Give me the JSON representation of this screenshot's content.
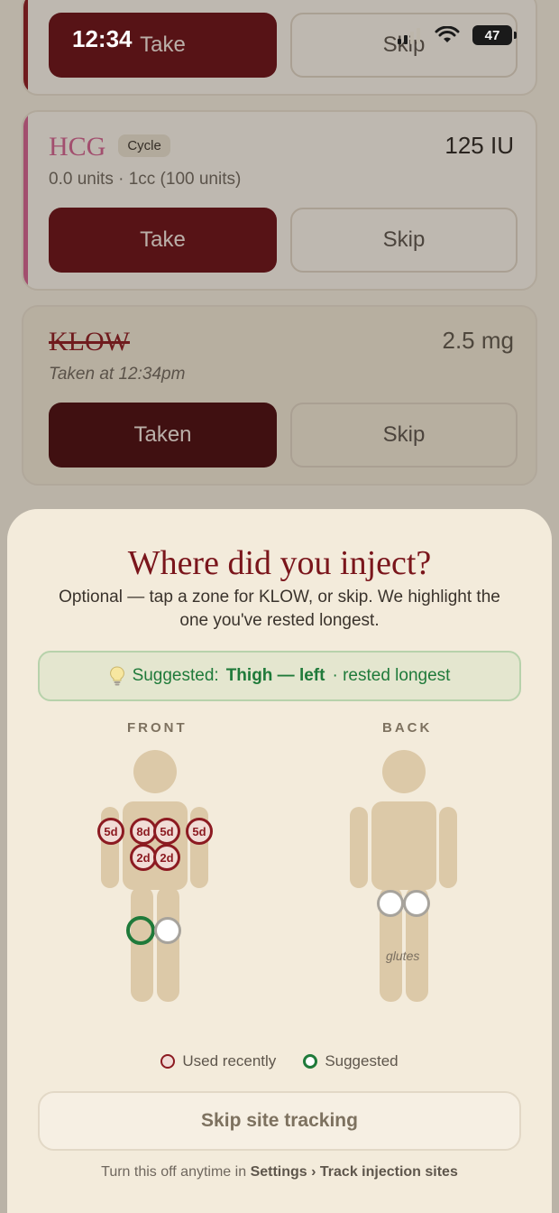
{
  "status_bar": {
    "time": "12:34",
    "battery": "47"
  },
  "cards": [
    {
      "take_label": "Take",
      "skip_label": "Skip"
    },
    {
      "name": "HCG",
      "tag": "Cycle",
      "dose": "125 IU",
      "sub": "0.0 units · 1cc (100 units)",
      "take_label": "Take",
      "skip_label": "Skip",
      "accent": "#d1608f",
      "name_color": "#d1608f"
    },
    {
      "name": "KLOW",
      "dose": "2.5 mg",
      "sub": "Taken at 12:34pm",
      "take_label": "Taken",
      "skip_label": "Skip",
      "accent": "#8c1a21",
      "name_color": "#8c1a21"
    }
  ],
  "sheet": {
    "title": "Where did you inject?",
    "description": "Optional — tap a zone for KLOW, or skip. We highlight the one you've rested longest.",
    "suggestion": {
      "prefix": "Suggested:",
      "site": "Thigh — left",
      "suffix": "· rested longest",
      "icon": "lightbulb-icon"
    },
    "front_label": "FRONT",
    "back_label": "BACK",
    "front_sites": [
      {
        "label": "5d",
        "status": "used"
      },
      {
        "label": "8d",
        "status": "used"
      },
      {
        "label": "5d",
        "status": "used"
      },
      {
        "label": "5d",
        "status": "used"
      },
      {
        "label": "2d",
        "status": "used"
      },
      {
        "label": "2d",
        "status": "used"
      },
      {
        "label": "",
        "status": "suggested"
      },
      {
        "label": "",
        "status": "available"
      }
    ],
    "back_sites": [
      {
        "label": "",
        "status": "available"
      },
      {
        "label": "",
        "status": "available"
      }
    ],
    "glutes_label": "glutes",
    "legend": {
      "used": "Used recently",
      "suggested": "Suggested"
    },
    "skip_button": "Skip site tracking",
    "footer_prefix": "Turn this off anytime in",
    "footer_path": "Settings › Track injection sites"
  },
  "colors": {
    "brand": "#6a0f16",
    "accent_red": "#8c1a21",
    "suggest_green": "#1f7a3a",
    "sheet_bg": "#f3ebdb"
  }
}
